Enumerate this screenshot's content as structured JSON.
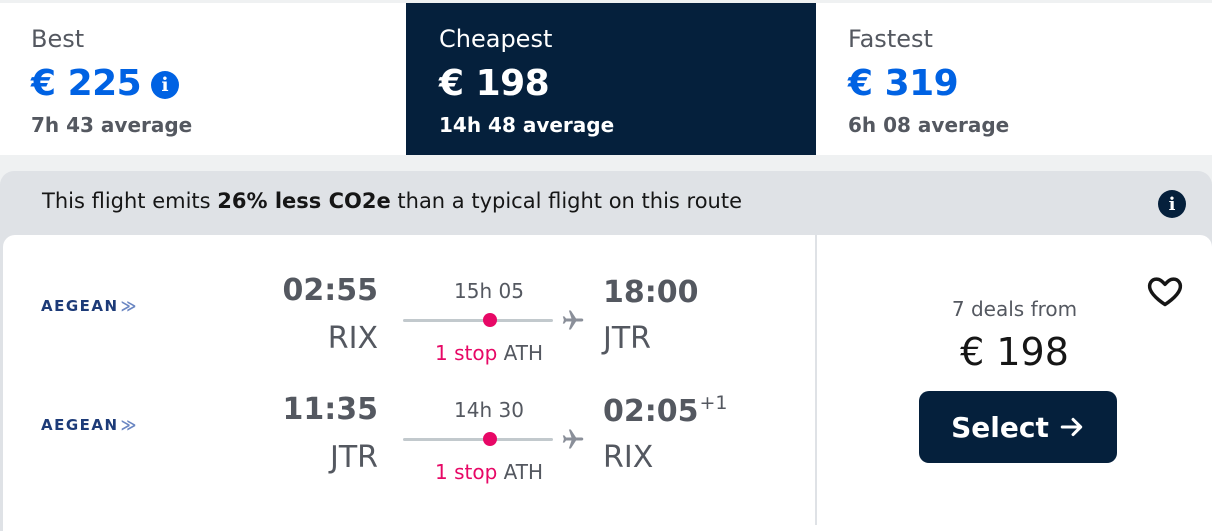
{
  "sort_tabs": [
    {
      "label": "Best",
      "price": "€ 225",
      "average": "7h 43 average",
      "selected": false
    },
    {
      "label": "Cheapest",
      "price": "€ 198",
      "average": "14h 48 average",
      "selected": true
    },
    {
      "label": "Fastest",
      "price": "€ 319",
      "average": "6h 08 average",
      "selected": false
    }
  ],
  "eco": {
    "prefix": "This flight emits ",
    "highlight": "26% less CO2e",
    "suffix": " than a typical flight on this route"
  },
  "result": {
    "legs": [
      {
        "airline": "AEGEAN",
        "dep_time": "02:55",
        "dep_code": "RIX",
        "duration": "15h 05",
        "stops": "1 stop",
        "stop_airport": "ATH",
        "arr_time": "18:00",
        "arr_day_offset": "",
        "arr_code": "JTR"
      },
      {
        "airline": "AEGEAN",
        "dep_time": "11:35",
        "dep_code": "JTR",
        "duration": "14h 30",
        "stops": "1 stop",
        "stop_airport": "ATH",
        "arr_time": "02:05",
        "arr_day_offset": "+1",
        "arr_code": "RIX"
      }
    ],
    "deals": "7 deals from",
    "price": "€ 198",
    "select_label": "Select"
  },
  "colors": {
    "brand_dark": "#05203c",
    "brand_blue": "#0062e3",
    "stop_pink": "#e70866"
  }
}
